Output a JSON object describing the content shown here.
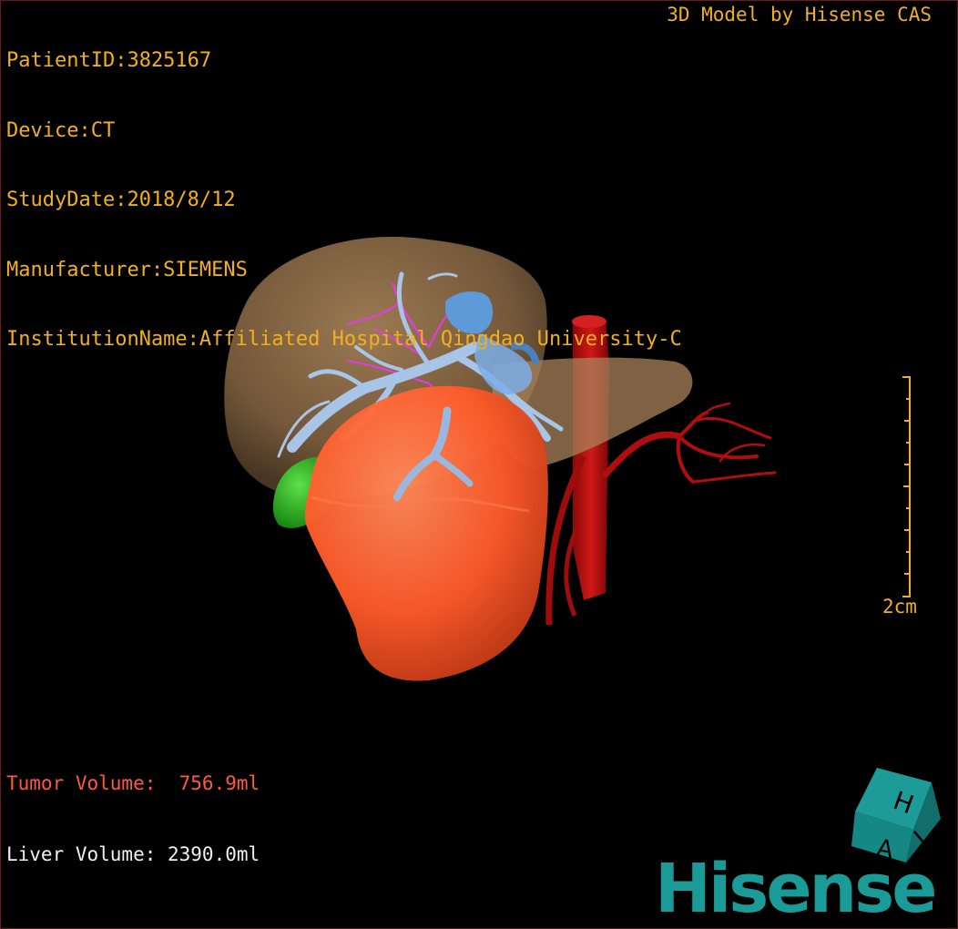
{
  "patient_info": {
    "patient_id": "PatientID:3825167",
    "device": "Device:CT",
    "study_date": "StudyDate:2018/8/12",
    "manufacturer": "Manufacturer:SIEMENS",
    "institution": "InstitutionName:Affiliated Hospital Qingdao University-C"
  },
  "credit": "3D Model by Hisense CAS",
  "volumes": {
    "tumor": "Tumor Volume:  756.9ml",
    "liver": "Liver Volume: 2390.0ml"
  },
  "scale_bar": {
    "label": "2cm"
  },
  "brand": {
    "name": "Hisense"
  },
  "orientation_cube": {
    "letters": [
      "H",
      "A",
      "L"
    ]
  },
  "colors": {
    "overlay_text": "#f2b01e",
    "tumor_text": "#ff5a3c",
    "liver_text": "#f0f0f0",
    "brand": "#1a9b98",
    "liver": "#8a6a45",
    "tumor": "#ff5a2a",
    "aorta": "#c01010",
    "portal_vein": "#a8c4e6",
    "hepatic_vein": "#5f9ad8",
    "bile_duct": "#e040e0",
    "gallbladder": "#2ec020",
    "cube": "#1d9b98"
  }
}
